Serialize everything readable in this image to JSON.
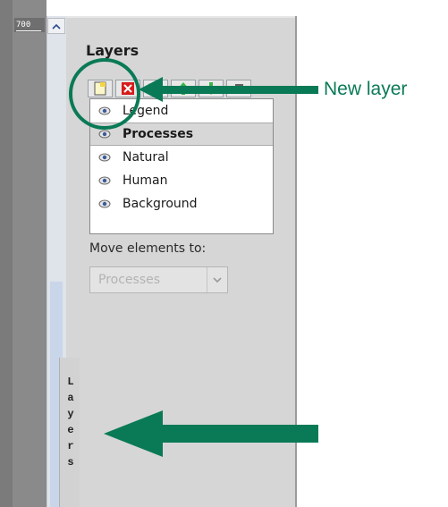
{
  "ruler": {
    "label": "700"
  },
  "panel": {
    "title": "Layers",
    "toolbar": [
      {
        "name": "new-layer",
        "icon": "new-layer-icon"
      },
      {
        "name": "delete-layer",
        "icon": "delete-layer-icon"
      },
      {
        "name": "merge-layer",
        "icon": "merge-layer-icon"
      },
      {
        "name": "move-up",
        "icon": "arrow-up-icon"
      },
      {
        "name": "move-down",
        "icon": "arrow-down-icon"
      },
      {
        "name": "layer-options",
        "icon": "list-icon"
      }
    ],
    "layers": [
      {
        "label": "Legend",
        "selected": false
      },
      {
        "label": "Processes",
        "selected": true
      },
      {
        "label": "Natural",
        "selected": false
      },
      {
        "label": "Human",
        "selected": false
      },
      {
        "label": "Background",
        "selected": false
      }
    ],
    "move_label": "Move elements to:",
    "move_select_value": "Processes"
  },
  "side_tab": {
    "label": "Layers"
  },
  "annotations": {
    "new_layer_label": "New layer",
    "color": "#0a7a56"
  }
}
